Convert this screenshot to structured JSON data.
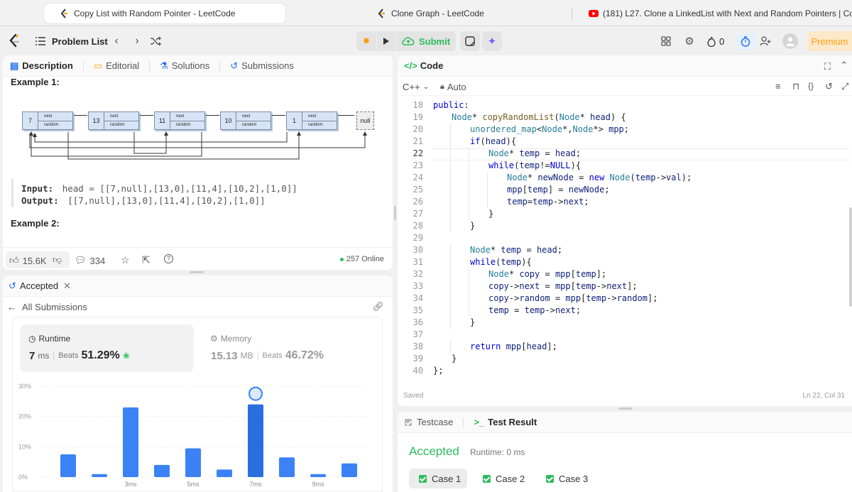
{
  "browser_tabs": [
    {
      "title": "Copy List with Random Pointer - LeetCode",
      "icon": "leetcode-icon"
    },
    {
      "title": "Clone Graph - LeetCode",
      "icon": "leetcode-icon"
    },
    {
      "title": "(181) L27. Clone a LinkedList with Next and Random Pointers | Cop...",
      "icon": "youtube-icon"
    }
  ],
  "nav": {
    "problem_list": "Problem List",
    "submit": "Submit",
    "streak": "0",
    "premium": "Premium"
  },
  "description_tabs": {
    "description": "Description",
    "editorial": "Editorial",
    "solutions": "Solutions",
    "submissions": "Submissions"
  },
  "example1": {
    "title": "Example 1:",
    "nodes": [
      "7",
      "13",
      "11",
      "10",
      "1"
    ],
    "next_label": "next",
    "random_label": "random",
    "null_label": "null",
    "input_label": "Input:",
    "input_value": "head = [[7,null],[13,0],[11,4],[10,2],[1,0]]",
    "output_label": "Output:",
    "output_value": "[[7,null],[13,0],[11,4],[10,2],[1,0]]"
  },
  "example2": {
    "title": "Example 2:"
  },
  "stats": {
    "likes": "15.6K",
    "comments": "334",
    "online": "257 Online"
  },
  "result_tab": {
    "label": "Accepted"
  },
  "submissions": {
    "all": "All Submissions",
    "runtime_label": "Runtime",
    "runtime_value": "7",
    "runtime_unit": "ms",
    "beats_label": "Beats",
    "runtime_beats": "51.29%",
    "memory_label": "Memory",
    "memory_value": "15.13",
    "memory_unit": "MB",
    "memory_beats": "46.72%"
  },
  "chart_data": {
    "type": "bar",
    "y_ticks": [
      "30%",
      "20%",
      "10%",
      "0%"
    ],
    "ylim": [
      0,
      30
    ],
    "x_tick_labels": [
      "3ms",
      "5ms",
      "7ms",
      "9ms"
    ],
    "values": [
      7.5,
      1,
      23,
      4,
      9.5,
      2.5,
      24,
      6.5,
      1,
      4.5
    ],
    "highlight_index": 6,
    "grid": true
  },
  "code": {
    "header": "Code",
    "language": "C++",
    "auto_label": "Auto",
    "saved": "Saved",
    "cursor": "Ln 22, Col 31",
    "current_line": 22,
    "lines": [
      {
        "n": "18",
        "indent": 0,
        "t": "public:"
      },
      {
        "n": "19",
        "indent": 1,
        "t": "Node* copyRandomList(Node* head) {"
      },
      {
        "n": "20",
        "indent": 2,
        "t": "unordered_map<Node*,Node*> mpp;"
      },
      {
        "n": "21",
        "indent": 2,
        "t": "if(head){"
      },
      {
        "n": "22",
        "indent": 3,
        "t": "Node* temp = head;"
      },
      {
        "n": "23",
        "indent": 3,
        "t": "while(temp!=NULL){"
      },
      {
        "n": "24",
        "indent": 4,
        "t": "Node* newNode = new Node(temp->val);"
      },
      {
        "n": "25",
        "indent": 4,
        "t": "mpp[temp] = newNode;"
      },
      {
        "n": "26",
        "indent": 4,
        "t": "temp=temp->next;"
      },
      {
        "n": "27",
        "indent": 3,
        "t": "}"
      },
      {
        "n": "28",
        "indent": 2,
        "t": "}"
      },
      {
        "n": "29",
        "indent": 0,
        "t": ""
      },
      {
        "n": "30",
        "indent": 2,
        "t": "Node* temp = head;"
      },
      {
        "n": "31",
        "indent": 2,
        "t": "while(temp){"
      },
      {
        "n": "32",
        "indent": 3,
        "t": "Node* copy = mpp[temp];"
      },
      {
        "n": "33",
        "indent": 3,
        "t": "copy->next = mpp[temp->next];"
      },
      {
        "n": "34",
        "indent": 3,
        "t": "copy->random = mpp[temp->random];"
      },
      {
        "n": "35",
        "indent": 3,
        "t": "temp = temp->next;"
      },
      {
        "n": "36",
        "indent": 2,
        "t": "}"
      },
      {
        "n": "37",
        "indent": 0,
        "t": ""
      },
      {
        "n": "38",
        "indent": 2,
        "t": "return mpp[head];"
      },
      {
        "n": "39",
        "indent": 1,
        "t": "}"
      },
      {
        "n": "40",
        "indent": 0,
        "t": "};"
      }
    ]
  },
  "testpanel": {
    "testcase": "Testcase",
    "test_result": "Test Result",
    "status": "Accepted",
    "runtime": "Runtime: 0 ms",
    "cases": [
      "Case 1",
      "Case 2",
      "Case 3"
    ]
  },
  "colors": {
    "accent_green": "#2cbb5d",
    "bar_blue": "#3b82f6",
    "premium_orange": "#ffa116"
  }
}
